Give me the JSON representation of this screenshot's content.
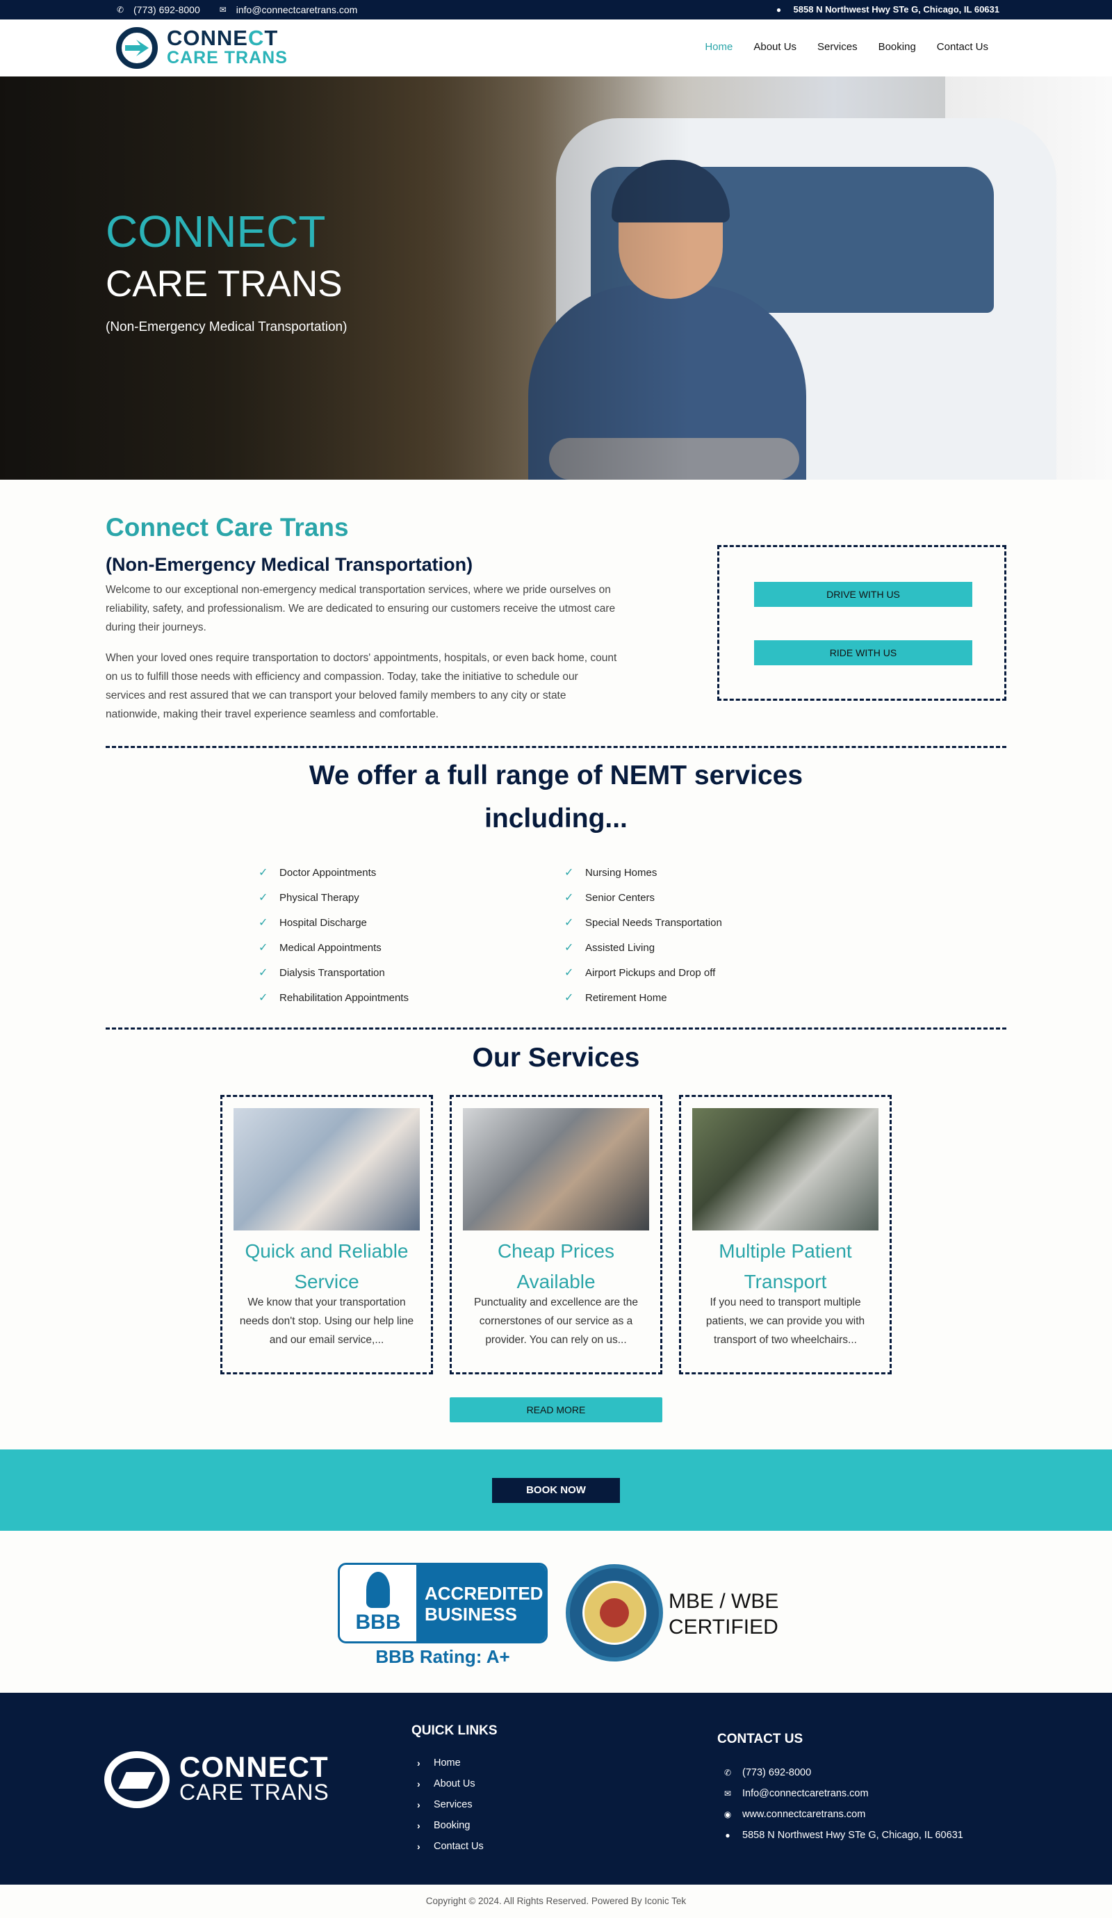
{
  "topbar": {
    "phone": "(773) 692-8000",
    "email": "info@connectcaretrans.com",
    "address": "5858 N Northwest Hwy STe G, Chicago, IL 60631"
  },
  "header": {
    "logo_line1_a": "CONNE",
    "logo_line1_b": "C",
    "logo_line1_c": "T",
    "logo_line2": "CARE TRANS",
    "nav": [
      "Home",
      "About Us",
      "Services",
      "Booking",
      "Contact Us"
    ],
    "active_nav": "Home"
  },
  "hero": {
    "title1": "CONNECT",
    "title2": "CARE TRANS",
    "subtitle": "(Non-Emergency Medical Transportation)"
  },
  "intro": {
    "heading": "Connect Care Trans",
    "subheading": "(Non-Emergency Medical Transportation)",
    "para1": "Welcome to our exceptional non-emergency medical transportation services, where we pride ourselves on reliability, safety, and professionalism. We are dedicated to ensuring our customers receive the utmost care during their journeys.",
    "para2": "When your loved ones require transportation to doctors' appointments, hospitals, or even back home, count on us to fulfill those needs with efficiency and compassion. Today, take the initiative to schedule our services and rest assured that we can transport your beloved family members to any city or state nationwide, making their travel experience seamless and comfortable.",
    "drive_btn": "DRIVE WITH US",
    "ride_btn": "RIDE WITH US"
  },
  "offer": {
    "title": "We offer a full range of NEMT services including...",
    "left": [
      "Doctor Appointments",
      "Physical Therapy",
      "Hospital Discharge",
      "Medical Appointments",
      "Dialysis Transportation",
      "Rehabilitation Appointments"
    ],
    "right": [
      "Nursing Homes",
      "Senior Centers",
      "Special Needs Transportation",
      "Assisted Living",
      "Airport Pickups and Drop off",
      "Retirement Home"
    ]
  },
  "services": {
    "title": "Our Services",
    "cards": [
      {
        "title": "Quick and Reliable Service",
        "text": "We know that your transportation needs don't stop. Using our help line and our email service,..."
      },
      {
        "title": "Cheap Prices Available",
        "text": "Punctuality and excellence are the cornerstones of our service as a provider. You can rely on us..."
      },
      {
        "title": "Multiple Patient Transport",
        "text": "If you need to transport multiple patients, we can provide you with transport of two wheelchairs..."
      }
    ],
    "read_more": "READ MORE"
  },
  "book": {
    "label": "BOOK NOW"
  },
  "badges": {
    "bbb_mark": "BBB",
    "bbb_line1": "ACCREDITED",
    "bbb_line2": "BUSINESS",
    "bbb_rating": "BBB Rating: A+",
    "mbe_line1": "MBE / WBE",
    "mbe_line2": "CERTIFIED"
  },
  "footer": {
    "logo_line1": "CONNECT",
    "logo_line2": "CARE TRANS",
    "quick_links_title": "QUICK LINKS",
    "quick_links": [
      "Home",
      "About Us",
      "Services",
      "Booking",
      "Contact Us"
    ],
    "contact_title": "CONTACT US",
    "contact": {
      "phone": "(773) 692-8000",
      "email": "Info@connectcaretrans.com",
      "website": "www.connectcaretrans.com",
      "address": "5858 N Northwest Hwy STe G, Chicago, IL 60631"
    }
  },
  "copyright": "Copyright © 2024. All Rights Reserved. Powered By Iconic Tek",
  "colors": {
    "navy": "#061a3c",
    "teal": "#2ebfc4",
    "teal_text": "#2aa5a9",
    "bbb_blue": "#0e6ca6"
  },
  "icons": {
    "phone": "phone-icon",
    "email": "envelope-icon",
    "location": "map-marker-icon",
    "globe": "globe-icon",
    "check": "check-icon",
    "arrow": "chevron-right-icon"
  }
}
